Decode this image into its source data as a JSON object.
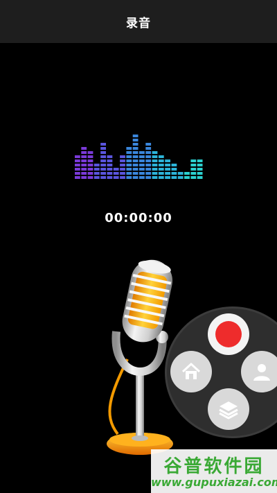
{
  "header": {
    "title": "录音"
  },
  "recorder": {
    "timer": "00:00:00"
  },
  "equalizer": {
    "levels": [
      6,
      8,
      7,
      4,
      9,
      6,
      3,
      6,
      8,
      11,
      7,
      9,
      7,
      6,
      5,
      4,
      2,
      2,
      5,
      5
    ],
    "colors": [
      "#7a3ad8",
      "#5a55dd",
      "#3a86db",
      "#2cb3d8",
      "#2bd0cf"
    ]
  },
  "radial_menu": {
    "items": [
      {
        "name": "record",
        "icon": "record-icon",
        "color": "#ee2c2c"
      },
      {
        "name": "home",
        "icon": "home-icon"
      },
      {
        "name": "profile",
        "icon": "user-icon"
      },
      {
        "name": "layers",
        "icon": "layers-icon"
      }
    ]
  },
  "watermark": {
    "brand": "谷普软件园",
    "url": "www.gupuxiazai.com"
  }
}
